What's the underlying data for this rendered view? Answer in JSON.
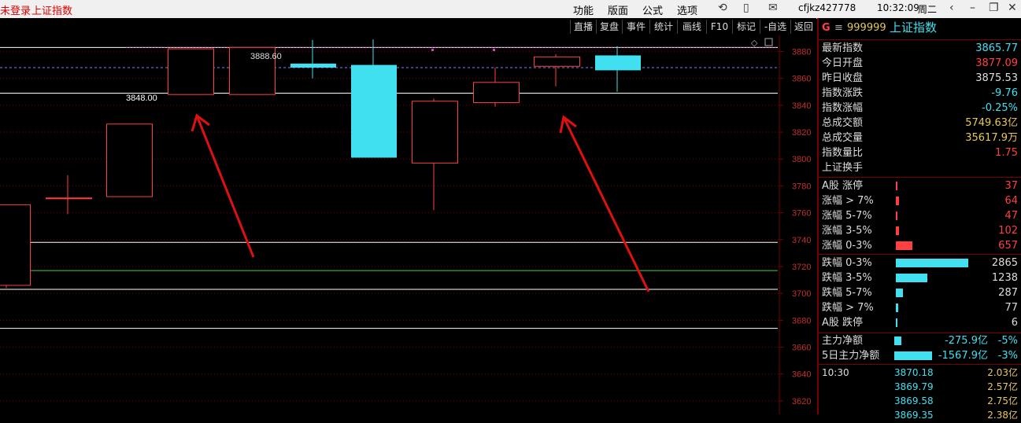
{
  "topbar": {
    "login": "未登录",
    "index_name": "上证指数",
    "menus": [
      "功能",
      "版面",
      "公式",
      "选项"
    ],
    "user": "cfjkz427778",
    "time": "10:32:09",
    "weekday": "周二"
  },
  "chart_toolbar": [
    "直播",
    "复盘",
    "事件",
    "统计",
    "画线",
    "F10",
    "标记",
    "-自选",
    "返回"
  ],
  "colors": {
    "up": "#ff4040",
    "down": "#40e0f0",
    "gold": "#e6c85a",
    "grid": "#7a0000"
  },
  "chart_data": {
    "type": "candlestick",
    "ylim": [
      3610,
      3890
    ],
    "y_ticks": [
      3620,
      3640,
      3660,
      3680,
      3700,
      3720,
      3740,
      3760,
      3780,
      3800,
      3820,
      3840,
      3860,
      3880
    ],
    "candles": [
      {
        "open": 3706,
        "close": 3766,
        "high": 3766,
        "low": 3704,
        "dir": "up"
      },
      {
        "open": 3771,
        "close": 3771,
        "high": 3788,
        "low": 3759,
        "dir": "flat"
      },
      {
        "open": 3772,
        "close": 3826,
        "high": 3826,
        "low": 3772,
        "dir": "up"
      },
      {
        "open": 3848,
        "close": 3882,
        "high": 3882,
        "low": 3848,
        "dir": "up"
      },
      {
        "open": 3848,
        "close": 3883,
        "high": 3883,
        "low": 3848,
        "dir": "up"
      },
      {
        "open": 3871,
        "close": 3868,
        "high": 3888.6,
        "low": 3860,
        "dir": "down"
      },
      {
        "open": 3870,
        "close": 3801,
        "high": 3889,
        "low": 3801,
        "dir": "down"
      },
      {
        "open": 3797,
        "close": 3843,
        "high": 3845,
        "low": 3762,
        "dir": "up"
      },
      {
        "open": 3842,
        "close": 3857,
        "high": 3868,
        "low": 3839,
        "dir": "up"
      },
      {
        "open": 3869,
        "close": 3876,
        "high": 3878,
        "low": 3854,
        "dir": "up"
      },
      {
        "open": 3877.09,
        "close": 3866,
        "high": 3884,
        "low": 3850,
        "dir": "down"
      }
    ],
    "annotations": {
      "high_label": "3888.60",
      "level_label": "3848.00"
    },
    "h_lines": [
      {
        "y": 3883,
        "color": "#ffffff"
      },
      {
        "y": 3849,
        "color": "#ffffff"
      },
      {
        "y": 3738,
        "color": "#ffffff"
      },
      {
        "y": 3717,
        "color": "#40d040"
      },
      {
        "y": 3703,
        "color": "#ffffff"
      },
      {
        "y": 3674,
        "color": "#ffffff"
      }
    ]
  },
  "panel": {
    "code_prefix": "G",
    "code": "999999",
    "name": "上证指数",
    "stats": [
      {
        "label": "最新指数",
        "value": "3865.77",
        "color": "#40e0f0"
      },
      {
        "label": "今日开盘",
        "value": "3877.09",
        "color": "#ff4040"
      },
      {
        "label": "昨日收盘",
        "value": "3875.53",
        "color": "#dddddd"
      },
      {
        "label": "指数涨跌",
        "value": "-9.76",
        "color": "#40e0f0"
      },
      {
        "label": "指数涨幅",
        "value": "-0.25%",
        "color": "#40e0f0"
      },
      {
        "label": "总成交额",
        "value": "5749.63亿",
        "color": "#e6c85a"
      },
      {
        "label": "总成交量",
        "value": "35617.9万",
        "color": "#e6c85a"
      },
      {
        "label": "指数量比",
        "value": "1.75",
        "color": "#ff4040"
      },
      {
        "label": "上证换手",
        "value": "",
        "color": "#dddddd"
      }
    ],
    "up_dist": [
      {
        "label": "A股 涨停",
        "value": "37",
        "bar": 0.02
      },
      {
        "label": "涨幅 > 7%",
        "value": "64",
        "bar": 0.04
      },
      {
        "label": "涨幅 5-7%",
        "value": "47",
        "bar": 0.02
      },
      {
        "label": "涨幅 3-5%",
        "value": "102",
        "bar": 0.04
      },
      {
        "label": "涨幅 0-3%",
        "value": "657",
        "bar": 0.23
      }
    ],
    "down_dist": [
      {
        "label": "跌幅 0-3%",
        "value": "2865",
        "bar": 1.0
      },
      {
        "label": "跌幅 3-5%",
        "value": "1238",
        "bar": 0.43
      },
      {
        "label": "跌幅 5-7%",
        "value": "287",
        "bar": 0.1
      },
      {
        "label": "跌幅 > 7%",
        "value": "77",
        "bar": 0.03
      },
      {
        "label": "A股 跌停",
        "value": "6",
        "bar": 0.01
      }
    ],
    "flows": [
      {
        "label": "主力净额",
        "value": "-275.9亿",
        "pct": "-5%",
        "bar": 0.14
      },
      {
        "label": "5日主力净额",
        "value": "-1567.9亿",
        "pct": "-3%",
        "bar": 0.78
      }
    ],
    "ticks": [
      {
        "time": "10:30",
        "price": "3870.18",
        "amount": "2.03亿"
      },
      {
        "time": "",
        "price": "3869.79",
        "amount": "2.57亿"
      },
      {
        "time": "",
        "price": "3869.58",
        "amount": "2.75亿"
      },
      {
        "time": "",
        "price": "3869.35",
        "amount": "2.38亿"
      }
    ]
  }
}
